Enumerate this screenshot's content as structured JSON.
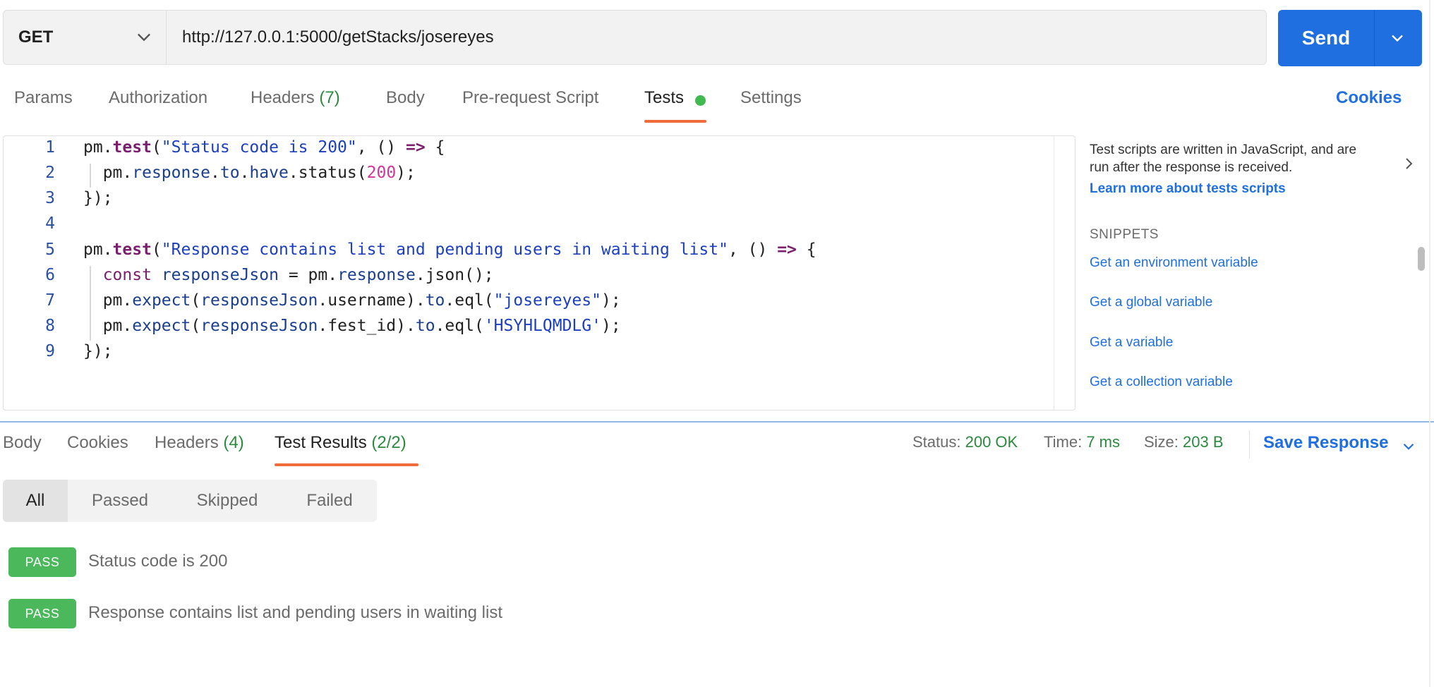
{
  "request": {
    "method": "GET",
    "url": "http://127.0.0.1:5000/getStacks/josereyes",
    "send_label": "Send"
  },
  "request_tabs": [
    {
      "label": "Params"
    },
    {
      "label": "Authorization"
    },
    {
      "label": "Headers",
      "count": "(7)"
    },
    {
      "label": "Body"
    },
    {
      "label": "Pre-request Script"
    },
    {
      "label": "Tests",
      "active": true
    },
    {
      "label": "Settings"
    }
  ],
  "cookies_label": "Cookies",
  "editor": {
    "line_numbers": [
      "1",
      "2",
      "3",
      "4",
      "5",
      "6",
      "7",
      "8",
      "9"
    ],
    "lines": [
      "pm.test(\"Status code is 200\", () => {",
      "  pm.response.to.have.status(200);",
      "});",
      "",
      "pm.test(\"Response contains list and pending users in waiting list\", () => {",
      "  const responseJson = pm.response.json();",
      "  pm.expect(responseJson.username).to.eql(\"josereyes\");",
      "  pm.expect(responseJson.fest_id).to.eql('HSYHLQMDLG');",
      "});"
    ]
  },
  "side_panel": {
    "description": "Test scripts are written in JavaScript, and are run after the response is received.",
    "learn_more": "Learn more about tests scripts",
    "snippets_heading": "SNIPPETS",
    "snippets": [
      "Get an environment variable",
      "Get a global variable",
      "Get a variable",
      "Get a collection variable"
    ]
  },
  "response_tabs": [
    {
      "label": "Body"
    },
    {
      "label": "Cookies"
    },
    {
      "label": "Headers",
      "count": "(4)"
    },
    {
      "label": "Test Results",
      "count": "(2/2)",
      "active": true
    }
  ],
  "response_meta": {
    "status_label": "Status:",
    "status_value": "200 OK",
    "time_label": "Time:",
    "time_value": "7 ms",
    "size_label": "Size:",
    "size_value": "203 B",
    "save_label": "Save Response"
  },
  "filters": [
    "All",
    "Passed",
    "Skipped",
    "Failed"
  ],
  "results": [
    {
      "badge": "PASS",
      "name": "Status code is 200"
    },
    {
      "badge": "PASS",
      "name": "Response contains list and pending users in waiting list"
    }
  ],
  "colors": {
    "accent": "#1f6fe0",
    "tab_underline": "#f26b3a",
    "pass": "#4cb85c",
    "success_text": "#2b8a3e"
  },
  "icons": {
    "method_dropdown": "chevron-down-icon",
    "send_dropdown": "chevron-down-icon",
    "side_panel": "chevron-right-icon",
    "save_dropdown": "chevron-down-icon",
    "tests_indicator": "dot-icon"
  }
}
